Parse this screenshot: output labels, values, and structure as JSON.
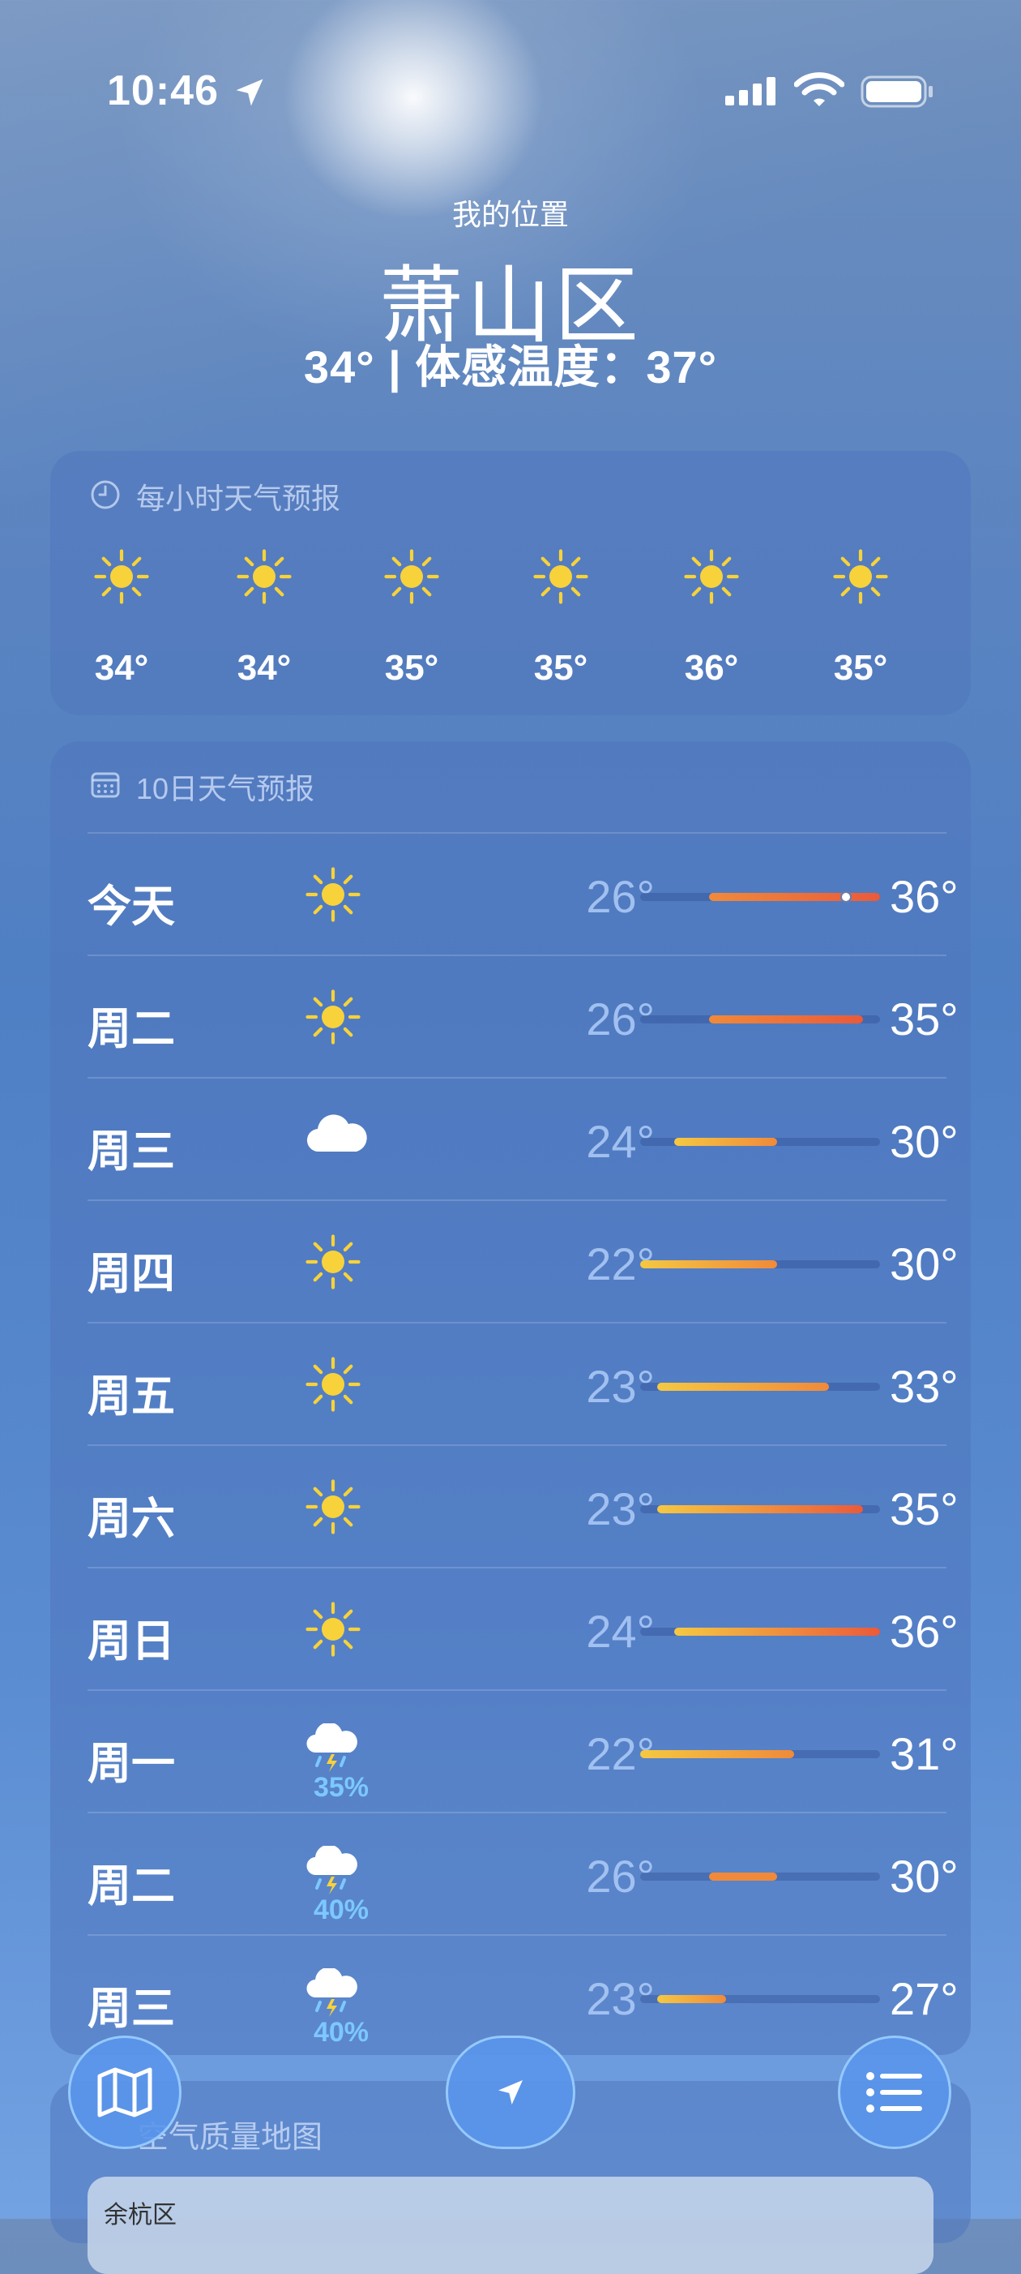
{
  "status_bar": {
    "time": "10:46"
  },
  "header": {
    "subtitle": "我的位置",
    "city": "萧山区",
    "current_and_feels": "34° | 体感温度：37°"
  },
  "hourly": {
    "title": "每小时天气预报",
    "items": [
      {
        "icon": "sun-icon",
        "temp": "34°"
      },
      {
        "icon": "sun-icon",
        "temp": "34°"
      },
      {
        "icon": "sun-icon",
        "temp": "35°"
      },
      {
        "icon": "sun-icon",
        "temp": "35°"
      },
      {
        "icon": "sun-icon",
        "temp": "36°"
      },
      {
        "icon": "sun-icon",
        "temp": "35°"
      }
    ]
  },
  "daily": {
    "title": "10日天气预报",
    "rows": [
      {
        "day": "今天",
        "icon": "sun-icon",
        "precip": "",
        "low": "26°",
        "high": "36°",
        "range": [
          26,
          36
        ],
        "current": 34
      },
      {
        "day": "周二",
        "icon": "sun-icon",
        "precip": "",
        "low": "26°",
        "high": "35°",
        "range": [
          26,
          35
        ]
      },
      {
        "day": "周三",
        "icon": "cloud-icon",
        "precip": "",
        "low": "24°",
        "high": "30°",
        "range": [
          24,
          30
        ]
      },
      {
        "day": "周四",
        "icon": "sun-icon",
        "precip": "",
        "low": "22°",
        "high": "30°",
        "range": [
          22,
          30
        ]
      },
      {
        "day": "周五",
        "icon": "sun-icon",
        "precip": "",
        "low": "23°",
        "high": "33°",
        "range": [
          23,
          33
        ]
      },
      {
        "day": "周六",
        "icon": "sun-icon",
        "precip": "",
        "low": "23°",
        "high": "35°",
        "range": [
          23,
          35
        ]
      },
      {
        "day": "周日",
        "icon": "sun-icon",
        "precip": "",
        "low": "24°",
        "high": "36°",
        "range": [
          24,
          36
        ]
      },
      {
        "day": "周一",
        "icon": "thunderstorm-icon",
        "precip": "35%",
        "low": "22°",
        "high": "31°",
        "range": [
          22,
          31
        ]
      },
      {
        "day": "周二",
        "icon": "thunderstorm-icon",
        "precip": "40%",
        "low": "26°",
        "high": "30°",
        "range": [
          26,
          30
        ]
      },
      {
        "day": "周三",
        "icon": "thunderstorm-icon",
        "precip": "40%",
        "low": "23°",
        "high": "27°",
        "range": [
          23,
          27
        ]
      }
    ]
  },
  "air_quality": {
    "title": "空气质量地图",
    "map_label": "余杭区"
  },
  "colors": {
    "cool": "#f5c842",
    "warm": "#f08a3a",
    "hot": "#ea5a3a",
    "precip": "#7cc8ff"
  }
}
